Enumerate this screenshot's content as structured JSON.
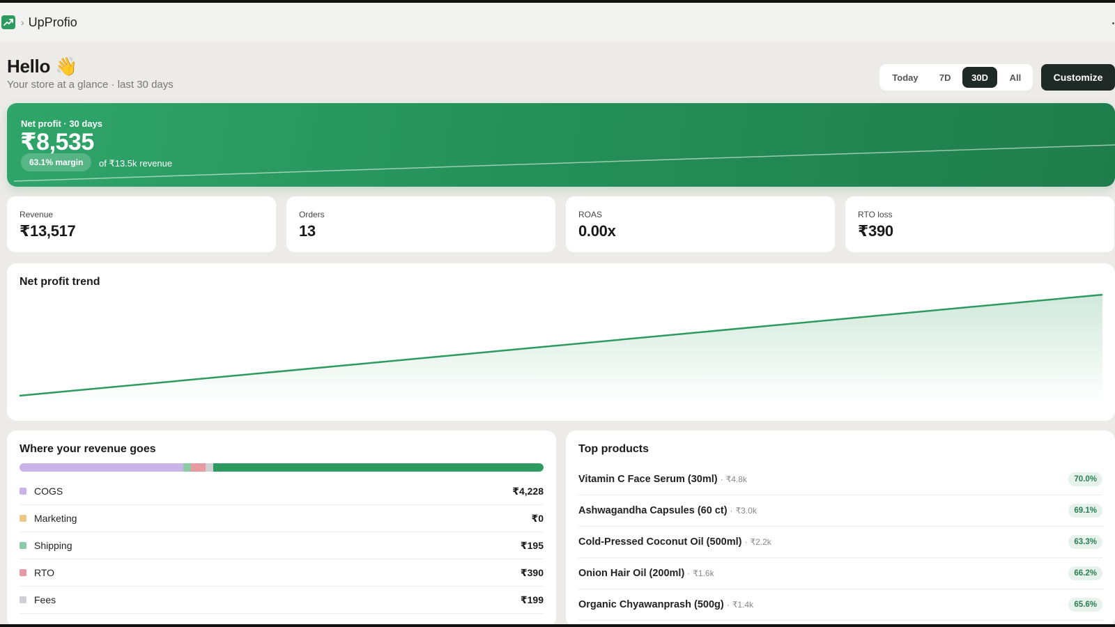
{
  "app": {
    "name": "UpProfio",
    "breadcrumb_sep": "›"
  },
  "greeting": {
    "title": "Hello 👋",
    "subtitle": "Your store at a glance · last 30 days"
  },
  "range": {
    "options": [
      {
        "label": "Today",
        "active": false
      },
      {
        "label": "7D",
        "active": false
      },
      {
        "label": "30D",
        "active": true
      },
      {
        "label": "All",
        "active": false
      }
    ],
    "customize_label": "Customize"
  },
  "hero": {
    "label": "Net profit · 30 days",
    "value": "₹8,535",
    "margin_pill": "63.1% margin",
    "note": "of ₹13.5k revenue"
  },
  "kpis": [
    {
      "label": "Revenue",
      "value": "₹13,517"
    },
    {
      "label": "Orders",
      "value": "13"
    },
    {
      "label": "ROAS",
      "value": "0.00x"
    },
    {
      "label": "RTO loss",
      "value": "₹390"
    }
  ],
  "trend": {
    "title": "Net profit trend",
    "line_color": "#2d9a5f"
  },
  "revenue_split": {
    "title": "Where your revenue goes",
    "items": [
      {
        "name": "COGS",
        "value": "₹4,228",
        "amount": 4228,
        "color": "#c8b4e6"
      },
      {
        "name": "Marketing",
        "value": "₹0",
        "amount": 0,
        "color": "#ecc987"
      },
      {
        "name": "Shipping",
        "value": "₹195",
        "amount": 195,
        "color": "#8ccaa8"
      },
      {
        "name": "RTO",
        "value": "₹390",
        "amount": 390,
        "color": "#e79aa2"
      },
      {
        "name": "Fees",
        "value": "₹199",
        "amount": 199,
        "color": "#cfcfd6"
      }
    ],
    "profit_amount": 8535,
    "profit_color": "#2d9a5f"
  },
  "top_products": {
    "title": "Top products",
    "items": [
      {
        "name": "Vitamin C Face Serum (30ml)",
        "revenue": "₹4.8k",
        "pct": "70.0%"
      },
      {
        "name": "Ashwagandha Capsules (60 ct)",
        "revenue": "₹3.0k",
        "pct": "69.1%"
      },
      {
        "name": "Cold-Pressed Coconut Oil (500ml)",
        "revenue": "₹2.2k",
        "pct": "63.3%"
      },
      {
        "name": "Onion Hair Oil (200ml)",
        "revenue": "₹1.6k",
        "pct": "66.2%"
      },
      {
        "name": "Organic Chyawanprash (500g)",
        "revenue": "₹1.4k",
        "pct": "65.6%"
      }
    ]
  }
}
